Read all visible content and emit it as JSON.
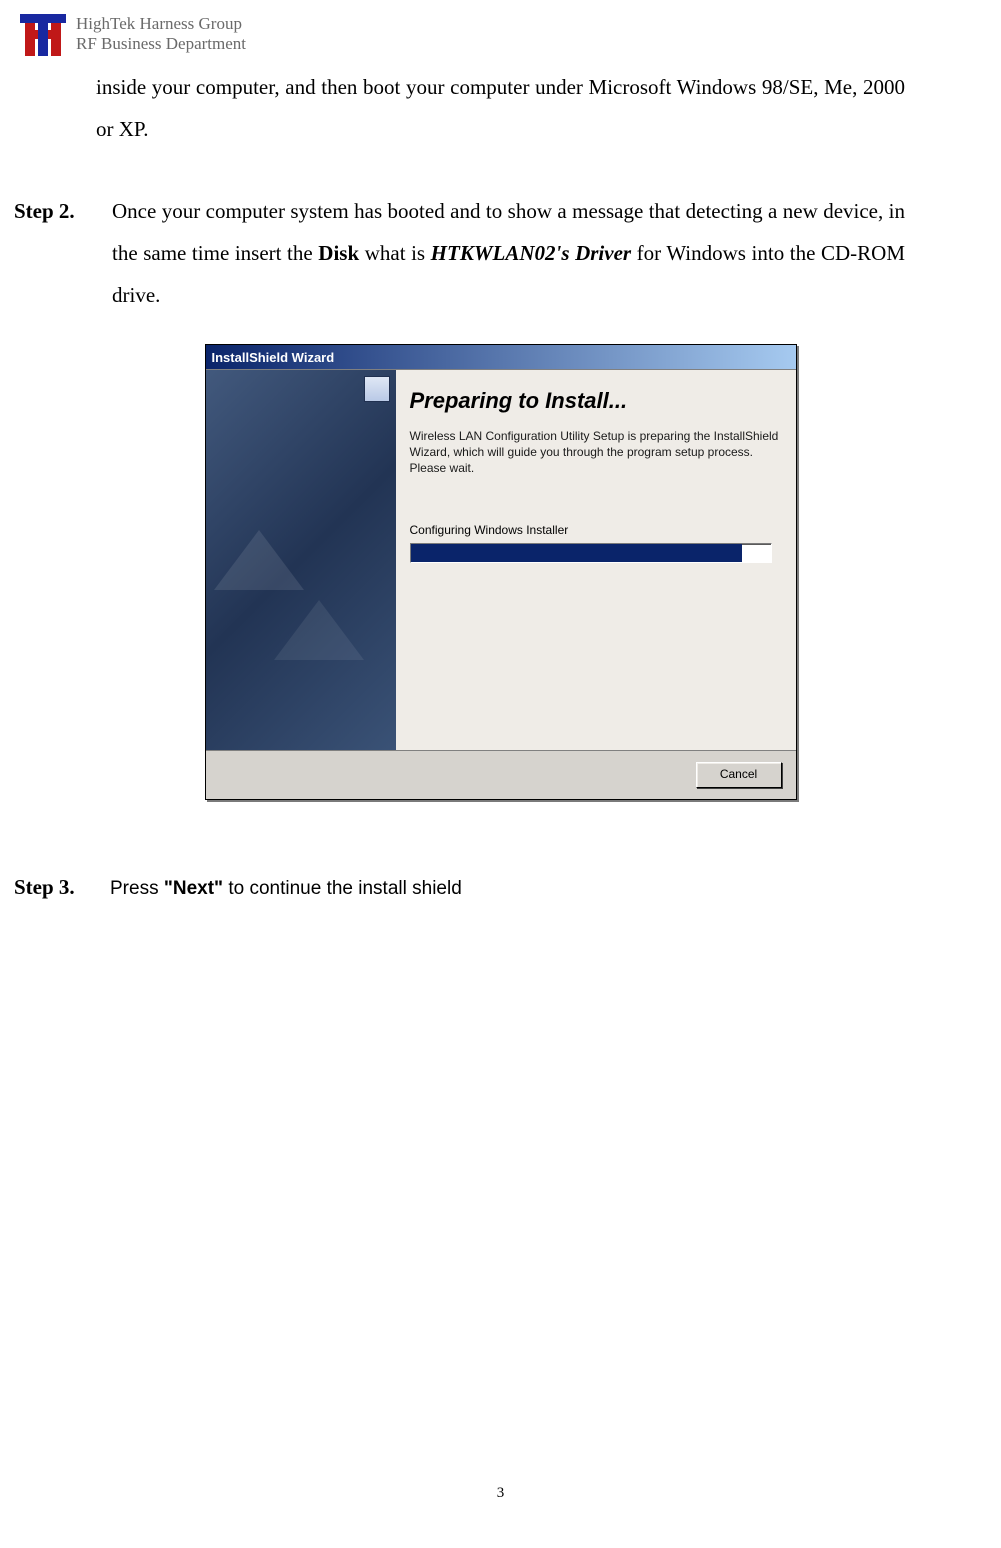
{
  "header": {
    "company": "HighTek Harness Group",
    "department": "RF Business Department"
  },
  "intro_continuation": "inside your computer, and then boot your computer under Microsoft Windows 98/SE, Me, 2000 or XP.",
  "step2": {
    "label": "Step 2.",
    "pre": "Once your computer system has booted and to show a message that detecting a new device, in the same time insert the ",
    "disk": "Disk",
    "mid": " what is ",
    "driver": "HTKWLAN02's Driver",
    "post": " for Windows into the CD-ROM drive."
  },
  "installer": {
    "titlebar": "InstallShield Wizard",
    "title": "Preparing to Install...",
    "desc": "Wireless LAN Configuration Utility Setup is preparing the InstallShield Wizard, which will guide you through the program setup process.  Please wait.",
    "status": "Configuring Windows Installer",
    "progress_percent": 92,
    "cancel": "Cancel"
  },
  "step3": {
    "label": "Step 3.",
    "pre": "Press ",
    "next": "\"Next\"",
    "post": " to continue the install shield"
  },
  "page_number": "3"
}
